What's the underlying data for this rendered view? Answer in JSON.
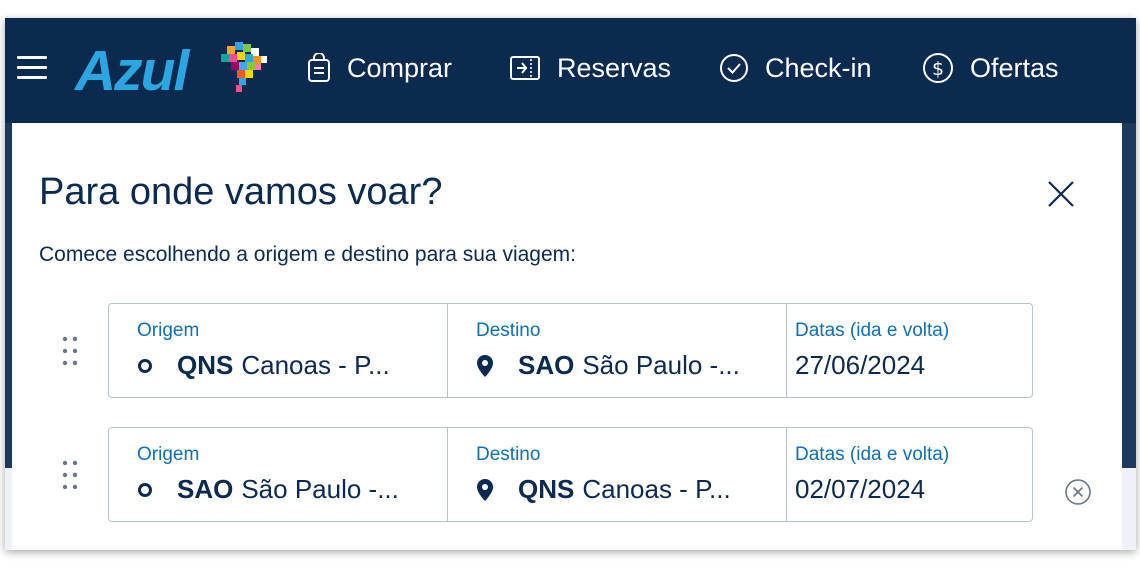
{
  "brand": {
    "name": "Azul",
    "colors": {
      "navy": "#0b2a4f",
      "brand_blue": "#2aa6e0",
      "label_blue": "#0f6fb8"
    }
  },
  "nav": {
    "items": [
      {
        "label": "Comprar",
        "icon": "shopping-bag-icon"
      },
      {
        "label": "Reservas",
        "icon": "ticket-icon"
      },
      {
        "label": "Check-in",
        "icon": "check-circle-icon"
      },
      {
        "label": "Ofertas",
        "icon": "dollar-circle-icon"
      }
    ]
  },
  "modal": {
    "title": "Para onde vamos voar?",
    "subtitle": "Comece escolhendo a origem e destino para sua viagem:",
    "routes": [
      {
        "origin_label": "Origem",
        "origin_code": "QNS",
        "origin_city": "Canoas - P...",
        "dest_label": "Destino",
        "dest_code": "SAO",
        "dest_city": "São Paulo -...",
        "dates_label": "Datas (ida e volta)",
        "date": "27/06/2024"
      },
      {
        "origin_label": "Origem",
        "origin_code": "SAO",
        "origin_city": "São Paulo -...",
        "dest_label": "Destino",
        "dest_code": "QNS",
        "dest_city": "Canoas - P...",
        "dates_label": "Datas (ida e volta)",
        "date": "02/07/2024"
      }
    ]
  }
}
